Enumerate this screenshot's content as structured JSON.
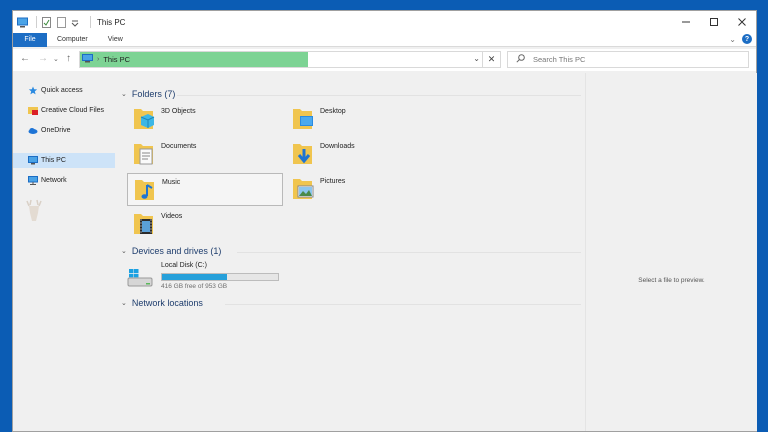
{
  "window": {
    "title": "This PC",
    "controls": [
      "minimize",
      "maximize",
      "close"
    ]
  },
  "ribbon": {
    "tabs": [
      "File",
      "Computer",
      "View"
    ]
  },
  "address": {
    "location": "This PC",
    "icon": "pc-icon"
  },
  "search": {
    "placeholder": "Search This PC"
  },
  "sidebar": {
    "items": [
      {
        "label": "Quick access",
        "icon": "star-icon"
      },
      {
        "label": "Creative Cloud Files",
        "icon": "cloud-folder-icon"
      },
      {
        "label": "OneDrive",
        "icon": "onedrive-icon"
      },
      {
        "label": "This PC",
        "icon": "pc-icon",
        "active": true
      },
      {
        "label": "Network",
        "icon": "network-icon"
      }
    ]
  },
  "main": {
    "folders_header": "Folders (7)",
    "folders": [
      {
        "name": "3D Objects",
        "icon": "3d-objects-folder-icon"
      },
      {
        "name": "Desktop",
        "icon": "desktop-folder-icon"
      },
      {
        "name": "Documents",
        "icon": "documents-folder-icon"
      },
      {
        "name": "Downloads",
        "icon": "downloads-folder-icon"
      },
      {
        "name": "Music",
        "icon": "music-folder-icon"
      },
      {
        "name": "Pictures",
        "icon": "pictures-folder-icon"
      },
      {
        "name": "Videos",
        "icon": "videos-folder-icon"
      }
    ],
    "drives_header": "Devices and drives (1)",
    "drive": {
      "name": "Local Disk (C:)",
      "free_text": "416 GB free of 953 GB",
      "used_fraction": 0.56
    },
    "network_header": "Network locations"
  },
  "preview": {
    "text": "Select a file to preview."
  },
  "colors": {
    "desktop": "#0b5cb4",
    "file_tab": "#1c6dc4",
    "address_highlight": "#7dd394",
    "drive_fill": "#26a0da",
    "selected_nav": "#cde3f8"
  }
}
